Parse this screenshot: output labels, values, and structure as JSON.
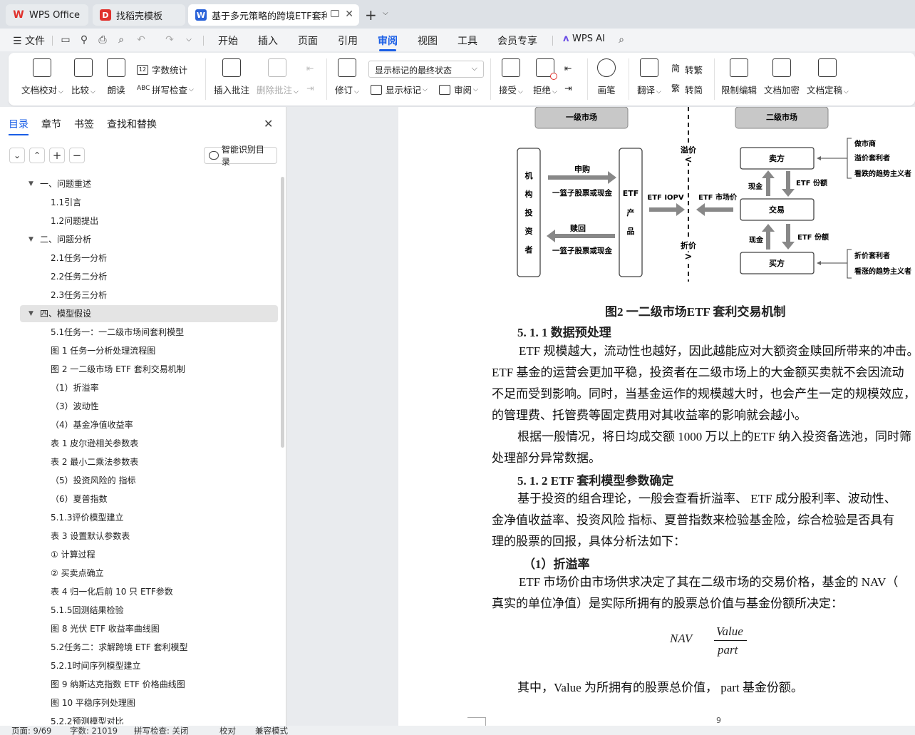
{
  "tabs": [
    {
      "label": "WPS Office",
      "icon": "wps-logo-icon",
      "color": "#e0312c"
    },
    {
      "label": "找稻壳模板",
      "icon": "docer-icon",
      "color": "#e0312c"
    },
    {
      "label": "基于多元策略的跨境ETF套利策",
      "icon": "word-doc-icon",
      "color": "#2b63d9"
    }
  ],
  "menu": {
    "file": "文件",
    "items": [
      "开始",
      "插入",
      "页面",
      "引用",
      "审阅",
      "视图",
      "工具",
      "会员专享"
    ],
    "active": "审阅",
    "ai": "WPS AI"
  },
  "ribbon": {
    "doc_check": "文档校对",
    "compare": "比较",
    "read_aloud": "朗读",
    "word_count": "字数统计",
    "spell_check": "拼写检查",
    "insert_comment": "插入批注",
    "delete_comment": "删除批注",
    "revise": "修订",
    "markup_state": "显示标记的最终状态",
    "show_markup": "显示标记",
    "review": "审阅",
    "accept": "接受",
    "reject": "拒绝",
    "pen": "画笔",
    "translate": "翻译",
    "to_traditional": "转繁",
    "to_simplified": "转简",
    "restrict_edit": "限制编辑",
    "encrypt": "文档加密",
    "finalize": "文档定稿"
  },
  "panel": {
    "tabs": [
      "目录",
      "章节",
      "书签",
      "查找和替换"
    ],
    "smart_toc": "智能识别目录",
    "toc": [
      {
        "label": "一、问题重述",
        "level": 0,
        "expandable": true
      },
      {
        "label": "1.1引言",
        "level": 1
      },
      {
        "label": "1.2问题提出",
        "level": 1
      },
      {
        "label": "二、问题分析",
        "level": 0,
        "expandable": true
      },
      {
        "label": "2.1任务一分析",
        "level": 1
      },
      {
        "label": "2.2任务二分析",
        "level": 1
      },
      {
        "label": "2.3任务三分析",
        "level": 1
      },
      {
        "label": "四、模型假设",
        "level": 0,
        "expandable": true,
        "selected": true
      },
      {
        "label": "5.1任务一：一二级市场间套利模型",
        "level": 1
      },
      {
        "label": "图 1 任务一分析处理流程图",
        "level": 1
      },
      {
        "label": "图 2 一二级市场 ETF 套利交易机制",
        "level": 1
      },
      {
        "label": "（1）折溢率",
        "level": 1
      },
      {
        "label": "（3）波动性",
        "level": 1
      },
      {
        "label": "（4）基金净值收益率",
        "level": 1
      },
      {
        "label": "表 1 皮尔逊相关参数表",
        "level": 1
      },
      {
        "label": "表 2 最小二乘法参数表",
        "level": 1
      },
      {
        "label": "（5）投资风险的    指标",
        "level": 1
      },
      {
        "label": "（6）夏普指数",
        "level": 1
      },
      {
        "label": "5.1.3评价模型建立",
        "level": 1
      },
      {
        "label": "表 3 设置默认参数表",
        "level": 1
      },
      {
        "label": "① 计算过程",
        "level": 1
      },
      {
        "label": "② 买卖点确立",
        "level": 1
      },
      {
        "label": "表 4 归一化后前 10 只 ETF参数",
        "level": 1
      },
      {
        "label": "5.1.5回测结果检验",
        "level": 1
      },
      {
        "label": "图 8 光伏 ETF 收益率曲线图",
        "level": 1
      },
      {
        "label": "5.2任务二：求解跨境 ETF 套利模型",
        "level": 1
      },
      {
        "label": "5.2.1时间序列模型建立",
        "level": 1
      },
      {
        "label": "图 9 纳斯达克指数 ETF 价格曲线图",
        "level": 1
      },
      {
        "label": "图 10 平稳序列处理图",
        "level": 1
      },
      {
        "label": "5.2.2预测模型对比",
        "level": 1
      }
    ]
  },
  "figure": {
    "primary_market": "一级市场",
    "secondary_market": "二级市场",
    "institution": [
      "机",
      "构",
      "投",
      "资",
      "者"
    ],
    "etf_product": [
      "ETF",
      "产",
      "品"
    ],
    "subscribe": "申购",
    "redeem": "赎回",
    "basket": "一篮子股票或现金",
    "premium": "溢价",
    "discount": "折价",
    "etf_iopv": "ETF IOPV",
    "etf_market_price": "ETF 市场价",
    "seller": "卖方",
    "trade": "交易",
    "buyer": "买方",
    "cash": "现金",
    "etf_share": "ETF 份额",
    "seller_types": [
      "做市商",
      "溢价套利者",
      "看跌的趋势主义者"
    ],
    "buyer_types": [
      "折价套利者",
      "看涨的趋势主义者"
    ]
  },
  "document": {
    "caption": "图2    一二级市场ETF 套利交易机制",
    "h_511": "5. 1. 1  数据预处理",
    "p1": [
      "ETF 规模越大，流动性也越好，因此越能应对大额资金赎回所带来的冲击。",
      "ETF 基金的运营会更加平稳，投资者在二级市场上的大金额买卖就不会因流动",
      "不足而受到影响。同时，当基金运作的规模越大时，也会产生一定的规模效应，基",
      "的管理费、托管费等固定费用对其收益率的影响就会越小。"
    ],
    "p2": [
      "根据一般情况，将日均成交额 1000 万以上的ETF 纳入投资备选池，同时筛",
      "处理部分异常数据。"
    ],
    "h_512": "5. 1. 2  ETF 套利模型参数确定",
    "p3": [
      "基于投资的组合理论，一般会查看折溢率、 ETF 成分股利率、波动性、",
      "金净值收益率、投资风险    指标、夏普指数来检验基金险，综合检验是否具有",
      "理的股票的回报，具体分析法如下："
    ],
    "h_1": "（1）折溢率",
    "p4": [
      "ETF 市场价由市场供求决定了其在二级市场的交易价格，基金的 NAV（",
      "真实的单位净值）是实际所拥有的股票总价值与基金份额所决定："
    ],
    "formula_lhs": "NAV",
    "formula_num": "Value",
    "formula_den": "part",
    "p5": "其中，Value 为所拥有的股票总价值，  part 基金份额。",
    "page_number": "9"
  },
  "status": {
    "page": "页面: 9/69",
    "words": "字数: 21019",
    "spell": "拼写检查: 关闭",
    "proof": "校对",
    "compat": "兼容模式"
  }
}
